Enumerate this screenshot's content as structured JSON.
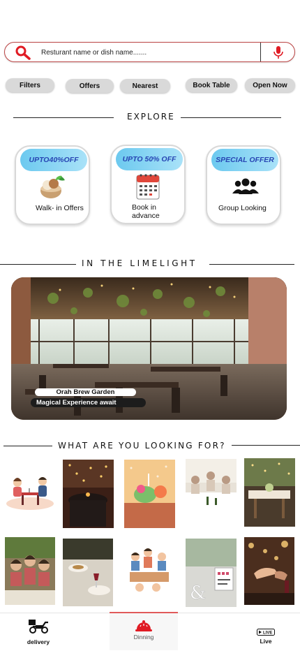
{
  "search": {
    "placeholder": "Resturant name or dish name......."
  },
  "filters": [
    {
      "label": "Filters"
    },
    {
      "label": "Offers"
    },
    {
      "label": "Nearest"
    },
    {
      "label": "Book Table"
    },
    {
      "label": "Open Now"
    }
  ],
  "explore": {
    "heading": "EXPLORE",
    "cards": [
      {
        "tag": "UPTO40%OFF",
        "label": "Walk- in Offers",
        "icon": "ice-cream-bowl-icon"
      },
      {
        "tag": "UPTO 50% OFF",
        "label": "Book in advance",
        "icon": "calendar-icon"
      },
      {
        "tag": "SPECIAL OFFER",
        "label": "Group Looking",
        "icon": "group-icon"
      }
    ]
  },
  "limelight": {
    "heading": "IN THE LIMELIGHT",
    "restaurant_name": "Orah Brew Garden",
    "tagline": "Magical Experience await"
  },
  "looking_for": {
    "heading": "WHAT ARE YOU LOOKING FOR?"
  },
  "bottom_nav": [
    {
      "label": "delivery",
      "icon": "delivery-scooter-icon"
    },
    {
      "label": "Dinning",
      "icon": "dining-cloche-icon",
      "active": true
    },
    {
      "label": "Live",
      "icon": "live-badge-icon"
    }
  ],
  "colors": {
    "accent_red": "#e01b24",
    "tag_blue": "#2745b3",
    "tag_gradient_start": "#6cc9ef",
    "chip_gray": "#d9d9d9"
  }
}
